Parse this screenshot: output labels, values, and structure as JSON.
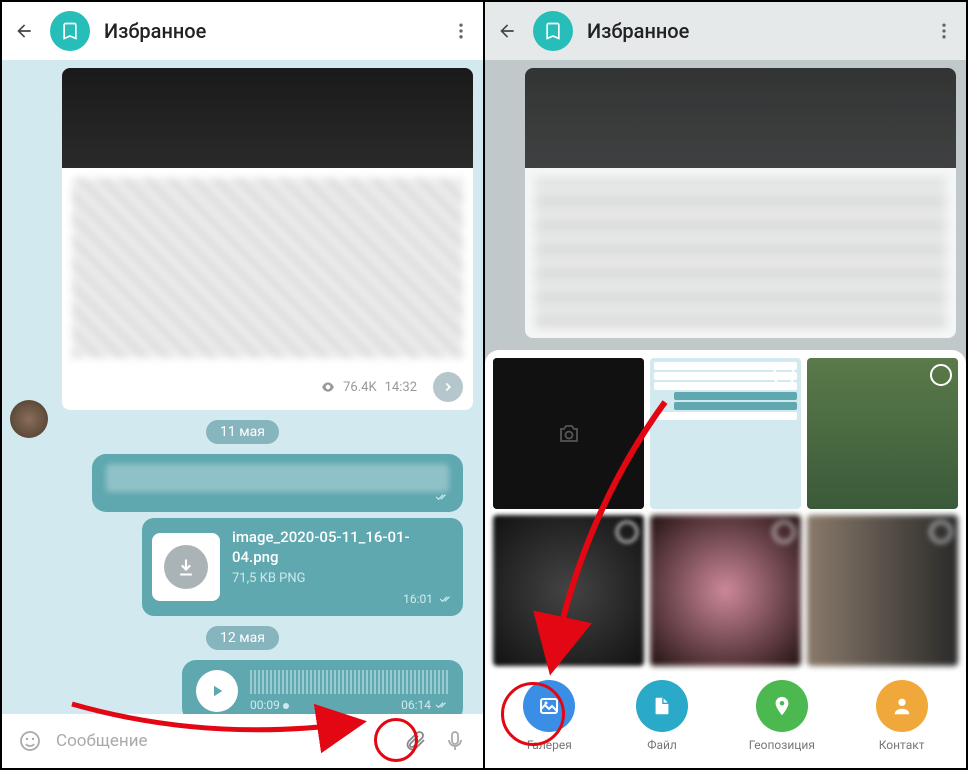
{
  "header": {
    "title": "Избранное"
  },
  "messages": {
    "views": "76.4K",
    "forward_time": "14:32",
    "date1": "11 мая",
    "date2": "12 мая",
    "file_name": "image_2020-05-11_16-01-04.png",
    "file_size": "71,5 KB PNG",
    "file_time": "16:01",
    "audio_duration": "00:09",
    "audio_time": "06:14"
  },
  "input": {
    "placeholder": "Сообщение"
  },
  "attach": {
    "gallery": "Галерея",
    "file": "Файл",
    "location": "Геопозиция",
    "contact": "Контакт"
  },
  "colors": {
    "accent": "#27bdb8",
    "blue": "#3a8ee6",
    "green": "#4cb950",
    "yellow": "#f0a83a",
    "red": "#e30613"
  }
}
